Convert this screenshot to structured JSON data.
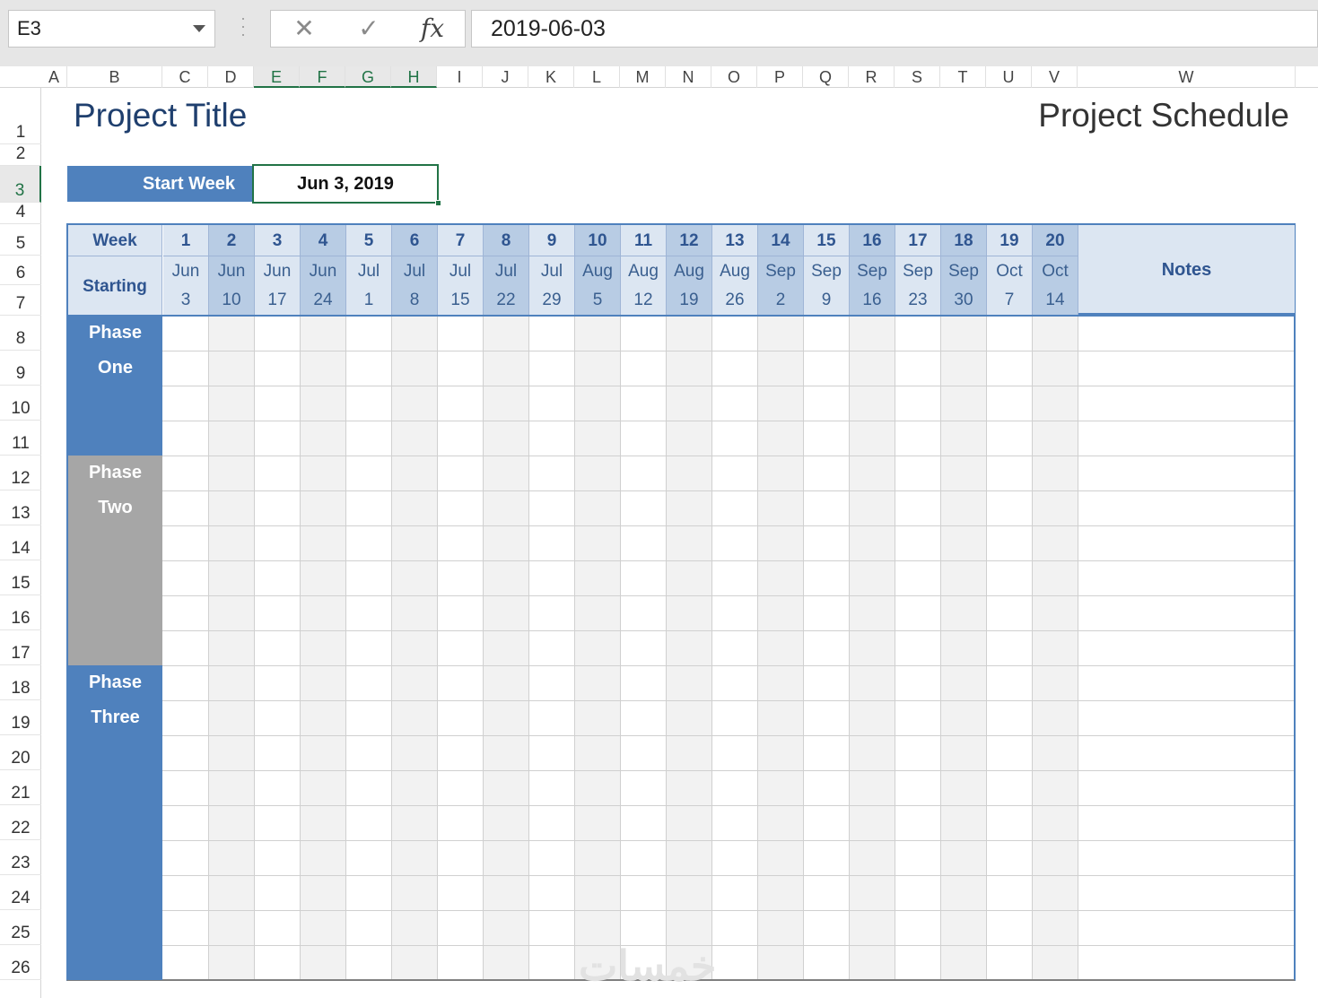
{
  "formula_bar": {
    "name_box": "E3",
    "cancel_icon": "✕",
    "enter_icon": "✓",
    "fx_label": "fx",
    "formula_value": "2019-06-03"
  },
  "columns": [
    "A",
    "B",
    "C",
    "D",
    "E",
    "F",
    "G",
    "H",
    "I",
    "J",
    "K",
    "L",
    "M",
    "N",
    "O",
    "P",
    "Q",
    "R",
    "S",
    "T",
    "U",
    "V",
    "W"
  ],
  "rows": [
    "1",
    "2",
    "3",
    "4",
    "5",
    "6",
    "7",
    "8",
    "9",
    "10",
    "11",
    "12",
    "13",
    "14",
    "15",
    "16",
    "17",
    "18",
    "19",
    "20",
    "21",
    "22",
    "23",
    "24",
    "25",
    "26"
  ],
  "selected_cell": {
    "column": "E",
    "row": "3"
  },
  "sheet": {
    "project_title": "Project Title",
    "project_schedule": "Project Schedule",
    "start_week_label": "Start Week",
    "start_week_value": "Jun 3, 2019",
    "week_label": "Week",
    "starting_label": "Starting",
    "notes_label": "Notes",
    "weeks": [
      {
        "num": "1",
        "month": "Jun",
        "day": "3"
      },
      {
        "num": "2",
        "month": "Jun",
        "day": "10"
      },
      {
        "num": "3",
        "month": "Jun",
        "day": "17"
      },
      {
        "num": "4",
        "month": "Jun",
        "day": "24"
      },
      {
        "num": "5",
        "month": "Jul",
        "day": "1"
      },
      {
        "num": "6",
        "month": "Jul",
        "day": "8"
      },
      {
        "num": "7",
        "month": "Jul",
        "day": "15"
      },
      {
        "num": "8",
        "month": "Jul",
        "day": "22"
      },
      {
        "num": "9",
        "month": "Jul",
        "day": "29"
      },
      {
        "num": "10",
        "month": "Aug",
        "day": "5"
      },
      {
        "num": "11",
        "month": "Aug",
        "day": "12"
      },
      {
        "num": "12",
        "month": "Aug",
        "day": "19"
      },
      {
        "num": "13",
        "month": "Aug",
        "day": "26"
      },
      {
        "num": "14",
        "month": "Sep",
        "day": "2"
      },
      {
        "num": "15",
        "month": "Sep",
        "day": "9"
      },
      {
        "num": "16",
        "month": "Sep",
        "day": "16"
      },
      {
        "num": "17",
        "month": "Sep",
        "day": "23"
      },
      {
        "num": "18",
        "month": "Sep",
        "day": "30"
      },
      {
        "num": "19",
        "month": "Oct",
        "day": "7"
      },
      {
        "num": "20",
        "month": "Oct",
        "day": "14"
      }
    ],
    "phases": [
      {
        "line1": "Phase",
        "line2": "One",
        "color": "#4f81bd"
      },
      {
        "line1": "Phase",
        "line2": "Two",
        "color": "#a6a6a6"
      },
      {
        "line1": "Phase",
        "line2": "Three",
        "color": "#4f81bd"
      }
    ]
  },
  "colors": {
    "accent": "#4f81bd",
    "header_light": "#dce6f2",
    "header_dark": "#b8cce4",
    "selection": "#217346"
  }
}
